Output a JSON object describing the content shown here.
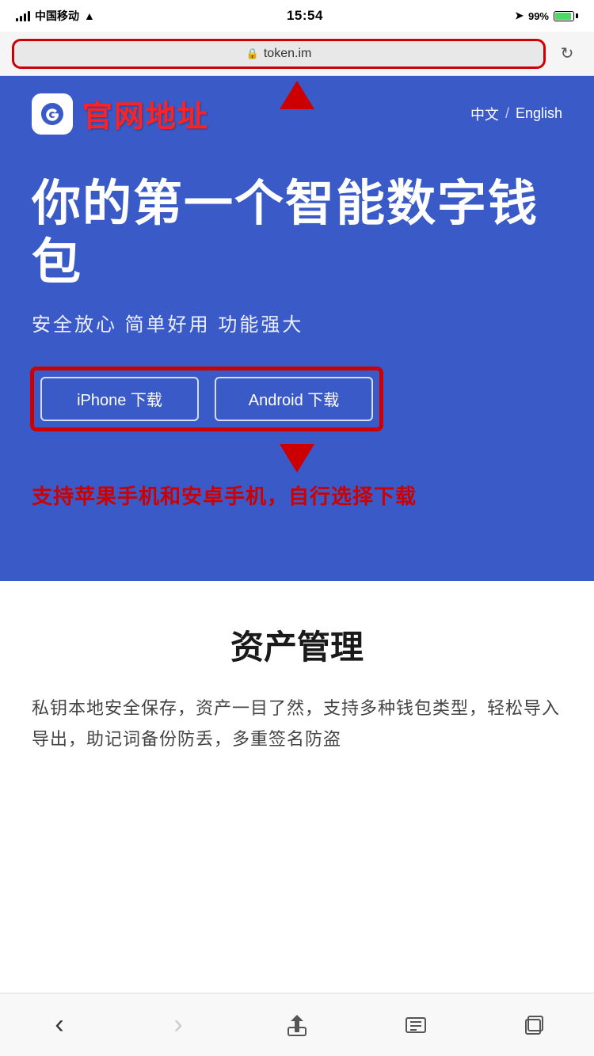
{
  "status_bar": {
    "carrier": "中国移动",
    "time": "15:54",
    "battery_percent": "99%",
    "signal": true,
    "wifi": true,
    "gps": true
  },
  "browser": {
    "url": "token.im",
    "refresh_label": "↻"
  },
  "header": {
    "logo_icon": "e",
    "logo_text": "官网地址",
    "lang_cn": "中文",
    "lang_divider": "/",
    "lang_en": "English"
  },
  "hero": {
    "title": "你的第一个智能数字钱包",
    "subtitle": "安全放心  简单好用  功能强大"
  },
  "buttons": {
    "iphone": "iPhone 下载",
    "android": "Android 下载"
  },
  "annotation": {
    "bottom_text": "支持苹果手机和安卓手机，自行选择下载"
  },
  "section": {
    "title": "资产管理",
    "body": "私钥本地安全保存，资产一目了然，支持多种钱包类型，轻松导入导出，助记词备份防丢，多重签名防盗"
  },
  "bottom_nav": {
    "back": "‹",
    "forward": "›",
    "share": "⬆",
    "bookmarks": "□□",
    "tabs": "⧉"
  }
}
